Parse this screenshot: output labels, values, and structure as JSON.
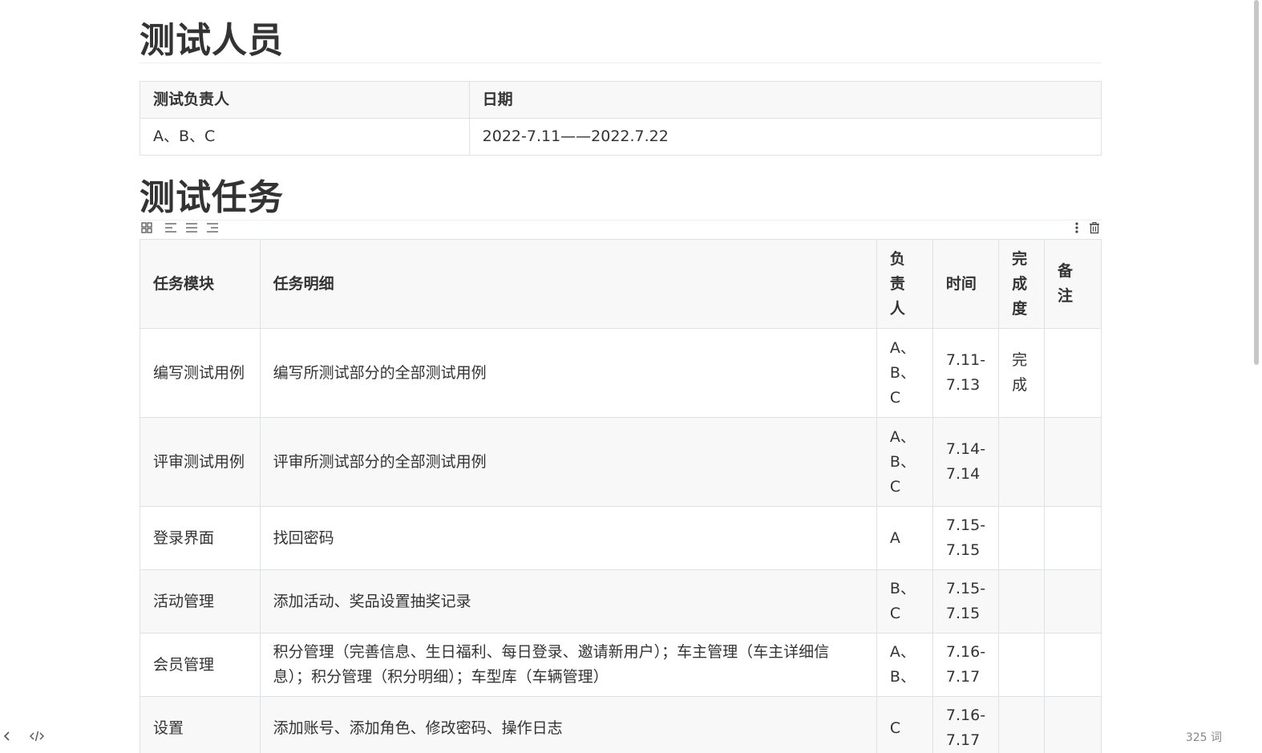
{
  "section1": {
    "title": "测试人员"
  },
  "people_table": {
    "headers": [
      "测试负责人",
      "日期"
    ],
    "row": [
      "A、B、C",
      "2022-7.11——2022.7.22"
    ]
  },
  "section2": {
    "title": "测试任务"
  },
  "table_toolbar": {
    "left_icons": [
      "grid-icon",
      "align-left-icon",
      "align-center-icon",
      "align-right-icon"
    ],
    "right_icons": [
      "more-vertical-icon",
      "trash-icon"
    ]
  },
  "task_table": {
    "headers": [
      "任务模块",
      "任务明细",
      "负责人",
      "时间",
      "完成度",
      "备注"
    ],
    "rows": [
      [
        "编写测试用例",
        "编写所测试部分的全部测试用例",
        "A、B、C",
        "7.11-7.13",
        "完成",
        ""
      ],
      [
        "评审测试用例",
        "评审所测试部分的全部测试用例",
        "A、B、C",
        "7.14-7.14",
        "",
        ""
      ],
      [
        "登录界面",
        "找回密码",
        "A",
        "7.15-7.15",
        "",
        ""
      ],
      [
        "活动管理",
        "添加活动、奖品设置抽奖记录",
        "B、C",
        "7.15-7.15",
        "",
        ""
      ],
      [
        "会员管理",
        "积分管理（完善信息、生日福利、每日登录、邀请新用户）；车主管理（车主详细信息）；积分管理（积分明细）；车型库（车辆管理）",
        "A、B、",
        "7.16-7.17",
        "",
        ""
      ],
      [
        "设置",
        "添加账号、添加角色、修改密码、操作日志",
        "C",
        "7.16-7.17",
        "",
        ""
      ]
    ]
  },
  "footer": {
    "word_count": "325 词",
    "left_icons": [
      "chevron-left-icon",
      "code-icon"
    ]
  }
}
